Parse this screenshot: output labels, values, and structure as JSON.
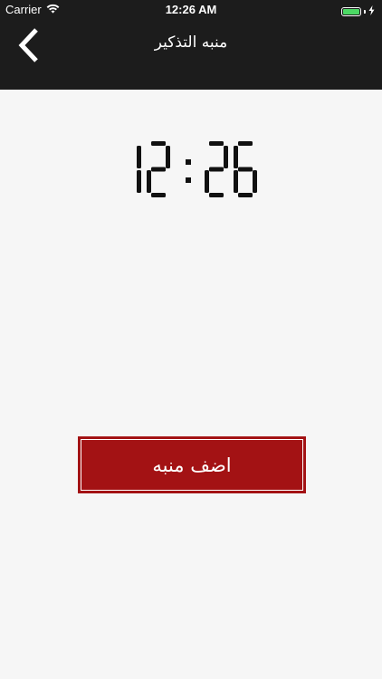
{
  "status_bar": {
    "carrier": "Carrier",
    "time": "12:26 AM",
    "battery_level": 1.0,
    "battery_color": "#4cd964"
  },
  "nav": {
    "title": "منبه التذكير",
    "back_icon": "chevron-left-icon"
  },
  "clock": {
    "digits": [
      "1",
      "2",
      "2",
      "6"
    ],
    "display": "12:26"
  },
  "add_button": {
    "label": "اضف منبه",
    "color": "#a31214"
  }
}
